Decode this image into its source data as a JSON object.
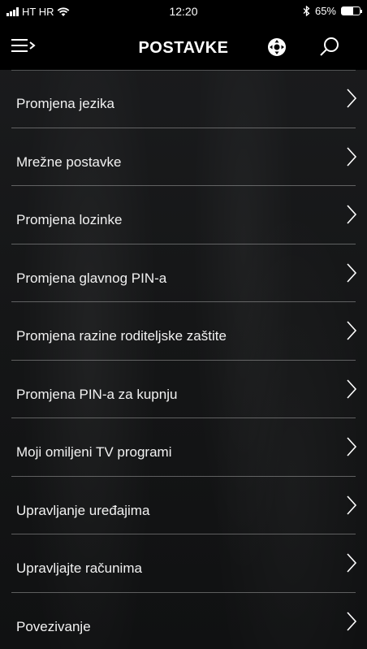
{
  "status_bar": {
    "carrier": "HT HR",
    "time": "12:20",
    "battery_percent": "65%",
    "battery_level": 0.65,
    "icons": [
      "signal-icon",
      "wifi-icon",
      "bluetooth-icon",
      "battery-icon"
    ]
  },
  "header": {
    "title": "POSTAVKE",
    "icons": [
      "menu-icon",
      "remote-control-icon",
      "search-icon"
    ]
  },
  "settings": {
    "items": [
      {
        "label": "Promjena jezika"
      },
      {
        "label": "Mrežne postavke"
      },
      {
        "label": "Promjena lozinke"
      },
      {
        "label": "Promjena glavnog PIN-a"
      },
      {
        "label": "Promjena razine roditeljske zaštite"
      },
      {
        "label": "Promjena PIN-a za kupnju"
      },
      {
        "label": "Moji omiljeni TV programi"
      },
      {
        "label": "Upravljanje uređajima"
      },
      {
        "label": "Upravljajte računima"
      },
      {
        "label": "Povezivanje"
      }
    ]
  },
  "colors": {
    "header_background": "#000000",
    "text": "#f2f2f2",
    "divider": "#555555"
  }
}
